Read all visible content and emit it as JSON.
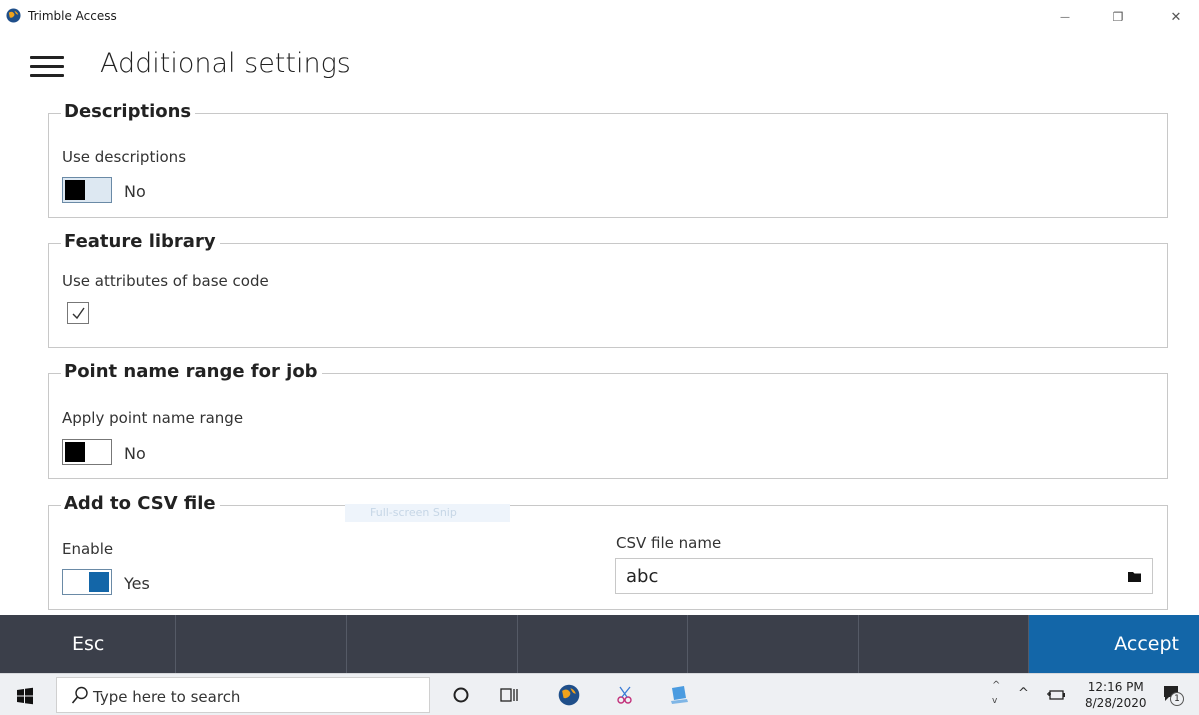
{
  "window": {
    "title": "Trimble Access",
    "minimize_glyph": "—",
    "restore_glyph": "❐",
    "close_glyph": "✕",
    "app_icon": "globe-icon"
  },
  "header": {
    "menu_icon": "hamburger-menu-icon",
    "title": "Additional settings"
  },
  "groups": {
    "descriptions": {
      "title": "Descriptions",
      "field_label": "Use descriptions",
      "toggle_text": "No"
    },
    "feature_library": {
      "title": "Feature library",
      "field_label": "Use attributes of base code"
    },
    "point_name_range": {
      "title": "Point name range for job",
      "field_label": "Apply point name range",
      "toggle_text": "No"
    },
    "csv": {
      "title": "Add to CSV file",
      "enable_label": "Enable",
      "toggle_text": "Yes",
      "file_label": "CSV file name",
      "file_value": "abc"
    }
  },
  "overlay": {
    "snip_text": "Full-screen Snip"
  },
  "softkeys": {
    "esc": "Esc",
    "accept": "Accept"
  },
  "taskbar": {
    "search_placeholder": "Type here to search",
    "time": "12:16 PM",
    "date": "8/28/2020",
    "notification_count": "1"
  },
  "colors": {
    "accent": "#1366a8",
    "softkey_bar": "#3b3f4a",
    "group_border": "#c8c8c8"
  }
}
